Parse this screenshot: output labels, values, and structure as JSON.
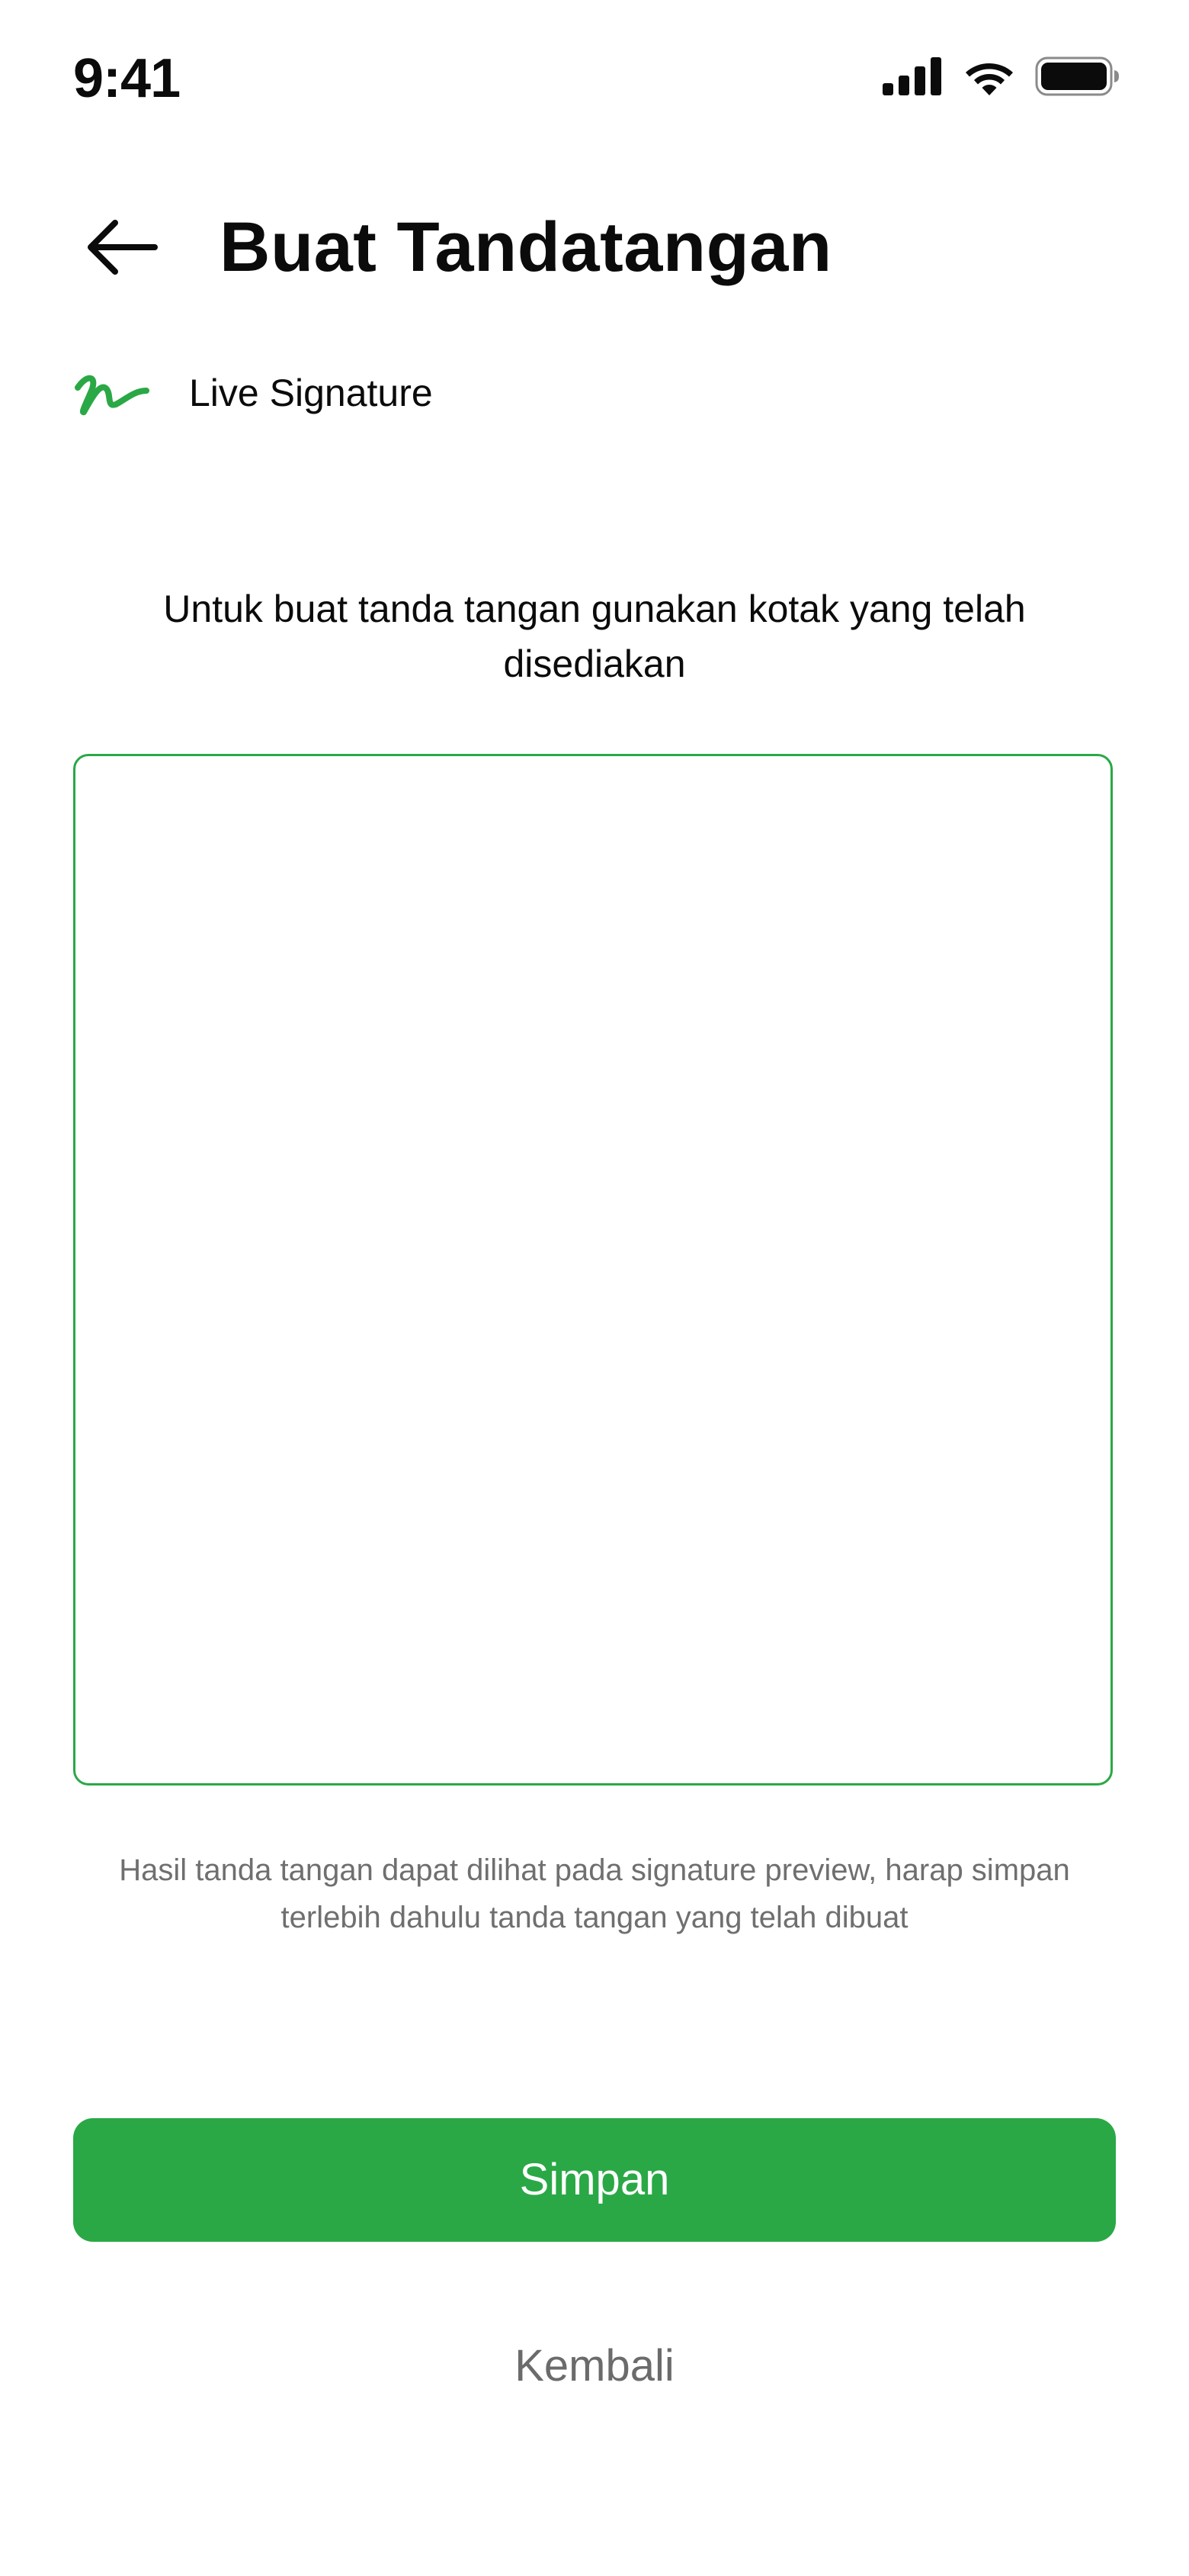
{
  "status_bar": {
    "time": "9:41",
    "icons": [
      "signal-icon",
      "wifi-icon",
      "battery-icon"
    ]
  },
  "header": {
    "back_icon": "arrow-left-icon",
    "title": "Buat Tandatangan"
  },
  "mode": {
    "icon": "signature-scribble-icon",
    "label": "Live Signature"
  },
  "instruction": "Untuk buat tanda tangan gunakan kotak yang telah disediakan",
  "hint": "Hasil tanda tangan dapat dilihat pada signature preview, harap simpan terlebih dahulu tanda tangan yang telah dibuat",
  "actions": {
    "save_label": "Simpan",
    "back_label": "Kembali"
  },
  "colors": {
    "accent": "#2aa846",
    "text_primary": "#0b0b0b",
    "text_muted": "#6f6f6f",
    "background": "#ffffff"
  }
}
